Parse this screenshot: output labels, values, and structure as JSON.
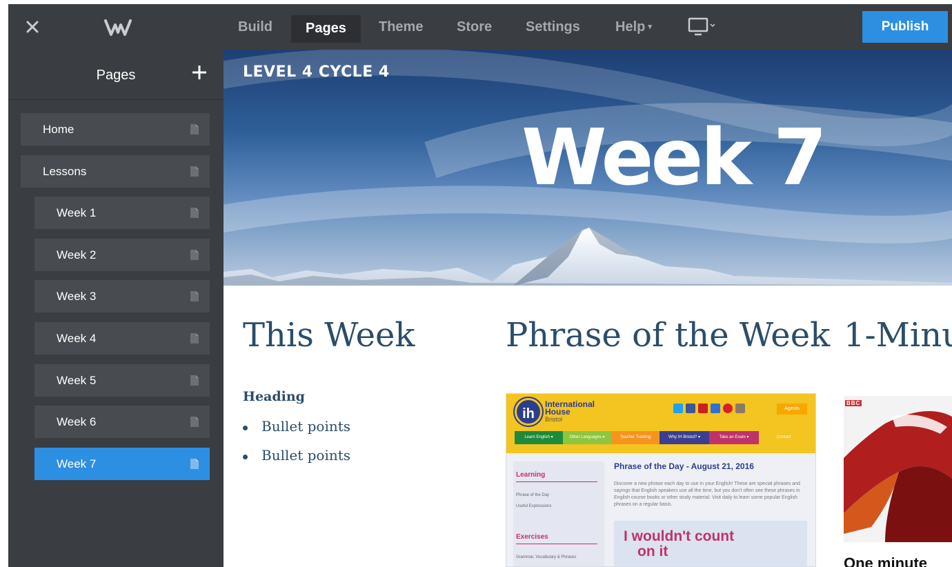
{
  "topbar": {
    "tabs": [
      "Build",
      "Pages",
      "Theme",
      "Store",
      "Settings",
      "Help"
    ],
    "active_tab": "Pages",
    "publish_label": "Publish"
  },
  "sidebar": {
    "title": "Pages",
    "pages": [
      {
        "label": "Home",
        "level": 0
      },
      {
        "label": "Lessons",
        "level": 0
      },
      {
        "label": "Week 1",
        "level": 1
      },
      {
        "label": "Week 2",
        "level": 1
      },
      {
        "label": "Week 3",
        "level": 1
      },
      {
        "label": "Week 4",
        "level": 1
      },
      {
        "label": "Week 5",
        "level": 1
      },
      {
        "label": "Week 6",
        "level": 1
      },
      {
        "label": "Week 7",
        "level": 1,
        "active": true
      }
    ]
  },
  "hero": {
    "site_title": "LEVEL 4 CYCLE 4",
    "heading": "Week 7"
  },
  "columns": {
    "this_week": {
      "title": "This Week",
      "heading": "Heading",
      "bullets": [
        "Bullet points",
        "Bullet points"
      ]
    },
    "phrase": {
      "title": "Phrase of the Week",
      "embed": {
        "brand_line1": "International",
        "brand_line2": "House",
        "brand_sub": "Bristol",
        "agents": "Agents",
        "nav": [
          "Learn English ▾",
          "Other Languages ▾",
          "Teacher Training",
          "Why IH Bristol? ▾",
          "Take an Exam ▾",
          "Contact"
        ],
        "left_heading1": "Learning",
        "left_items1": [
          "Phrase of the Day",
          "Useful Expressions"
        ],
        "left_heading2": "Exercises",
        "left_items2": [
          "Grammar, Vocabulary & Phrases"
        ],
        "pod_title": "Phrase of the Day - August 21, 2016",
        "pod_body": "Discover a new phrase each day to use in your English! These are special phrases and sayings that English speakers use all the time, but you don't often see these phrases in English course books or other study material. Visit daily to learn some popular English phrases on a regular basis.",
        "quote_line1": "I wouldn't count",
        "quote_line2": "on it"
      }
    },
    "minute": {
      "title": "1-Minu",
      "bbc": "BBC",
      "caption": "One minute"
    }
  },
  "colors": {
    "accent": "#2d8fe2",
    "chrome": "#3a3d41",
    "heading_text": "#2a4d6a"
  }
}
